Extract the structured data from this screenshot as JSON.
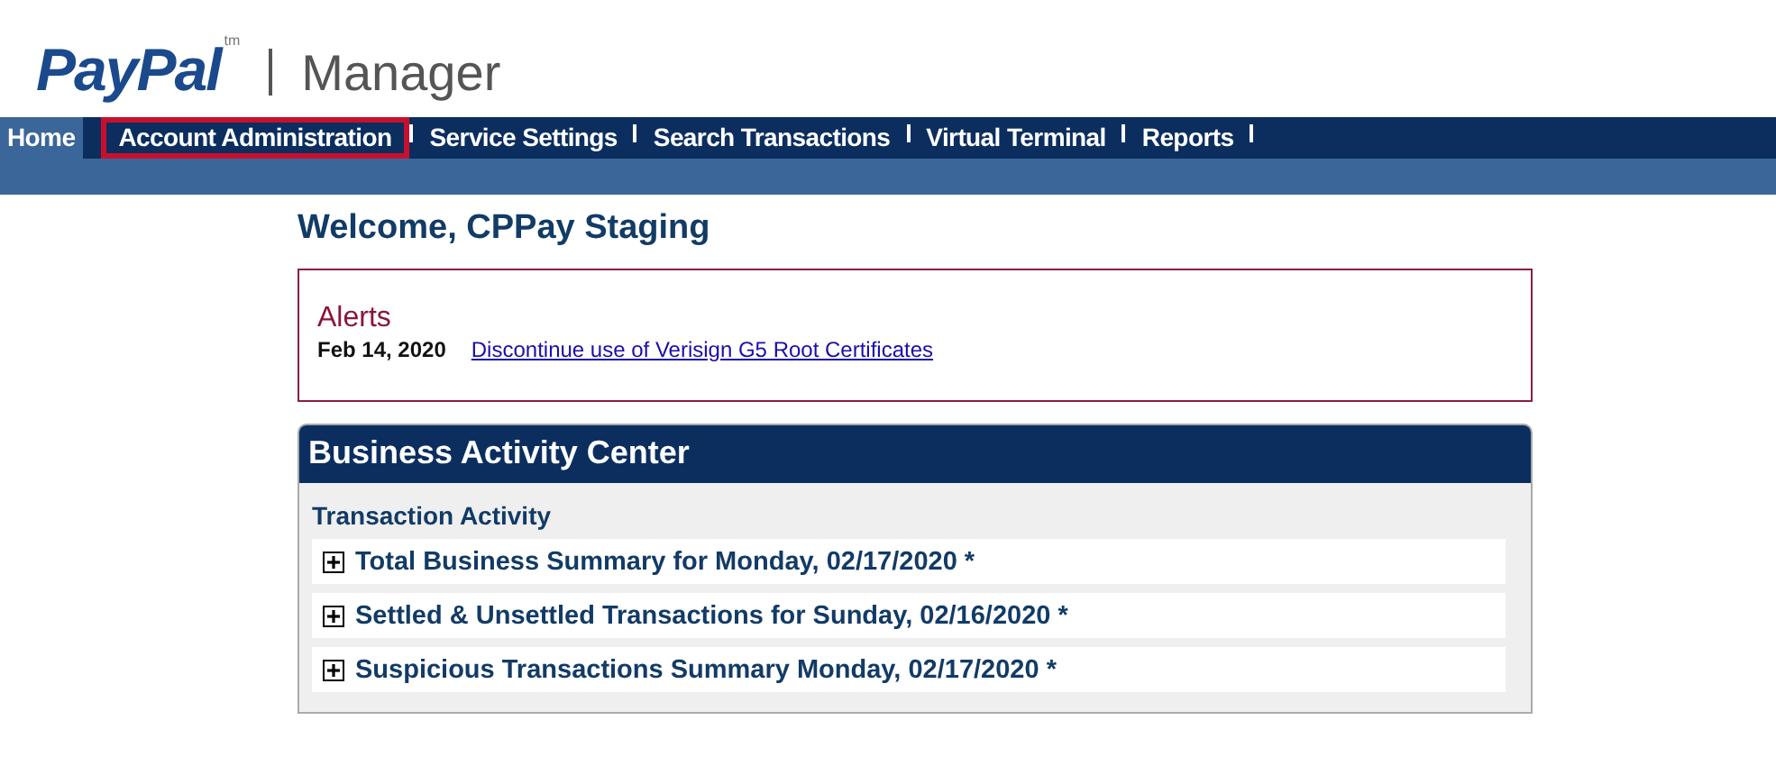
{
  "header": {
    "logo": "PayPal",
    "trademark": "tm",
    "product": "Manager"
  },
  "nav": [
    {
      "label": "Home",
      "selected": true,
      "highlighted": false
    },
    {
      "label": "Account Administration",
      "selected": false,
      "highlighted": true
    },
    {
      "label": "Service Settings",
      "selected": false,
      "highlighted": false
    },
    {
      "label": "Search Transactions",
      "selected": false,
      "highlighted": false
    },
    {
      "label": "Virtual Terminal",
      "selected": false,
      "highlighted": false
    },
    {
      "label": "Reports",
      "selected": false,
      "highlighted": false
    }
  ],
  "welcome": "Welcome, CPPay Staging",
  "alerts": {
    "title": "Alerts",
    "items": [
      {
        "date": "Feb 14, 2020",
        "link": "Discontinue use of Verisign G5 Root Certificates"
      }
    ]
  },
  "activity": {
    "title": "Business Activity Center",
    "section": "Transaction Activity",
    "rows": [
      {
        "label": "Total Business Summary for Monday, 02/17/2020 *",
        "expanded": false
      },
      {
        "label": "Settled & Unsettled Transactions for Sunday, 02/16/2020 *",
        "expanded": false
      },
      {
        "label": "Suspicious Transactions Summary Monday, 02/17/2020 *",
        "expanded": false
      }
    ]
  }
}
